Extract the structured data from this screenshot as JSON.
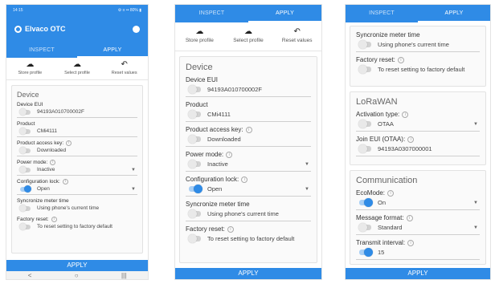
{
  "status": {
    "time": "14:15",
    "right": "⚙ ≡ •• 80% ▮"
  },
  "app": {
    "title": "Elvaco OTC"
  },
  "tabs": {
    "inspect": "INSPECT",
    "apply": "APPLY"
  },
  "toolbar": {
    "store": "Store profile",
    "select": "Select profile",
    "reset": "Reset values"
  },
  "device": {
    "title": "Device",
    "eui_label": "Device EUI",
    "eui_value": "94193A010700002F",
    "product_label": "Product",
    "product_value": "CMi4111",
    "access_label": "Product access key:",
    "access_value": "Downloaded",
    "power_label": "Power mode:",
    "power_value": "Inactive",
    "config_label": "Configuration lock:",
    "config_value": "Open",
    "sync_label": "Syncronize meter time",
    "sync_value": "Using phone's current time",
    "factory_label": "Factory reset:",
    "factory_value": "To reset setting to factory default"
  },
  "lorawan": {
    "title": "LoRaWAN",
    "activation_label": "Activation type:",
    "activation_value": "OTAA",
    "join_label": "Join EUI (OTAA):",
    "join_value": "94193A0307000001"
  },
  "communication": {
    "title": "Communication",
    "eco_label": "EcoMode:",
    "eco_value": "On",
    "format_label": "Message format:",
    "format_value": "Standard",
    "interval_label": "Transmit interval:",
    "interval_value": "15"
  },
  "apply_button": "APPLY",
  "colors": {
    "accent": "#2f8be6"
  }
}
